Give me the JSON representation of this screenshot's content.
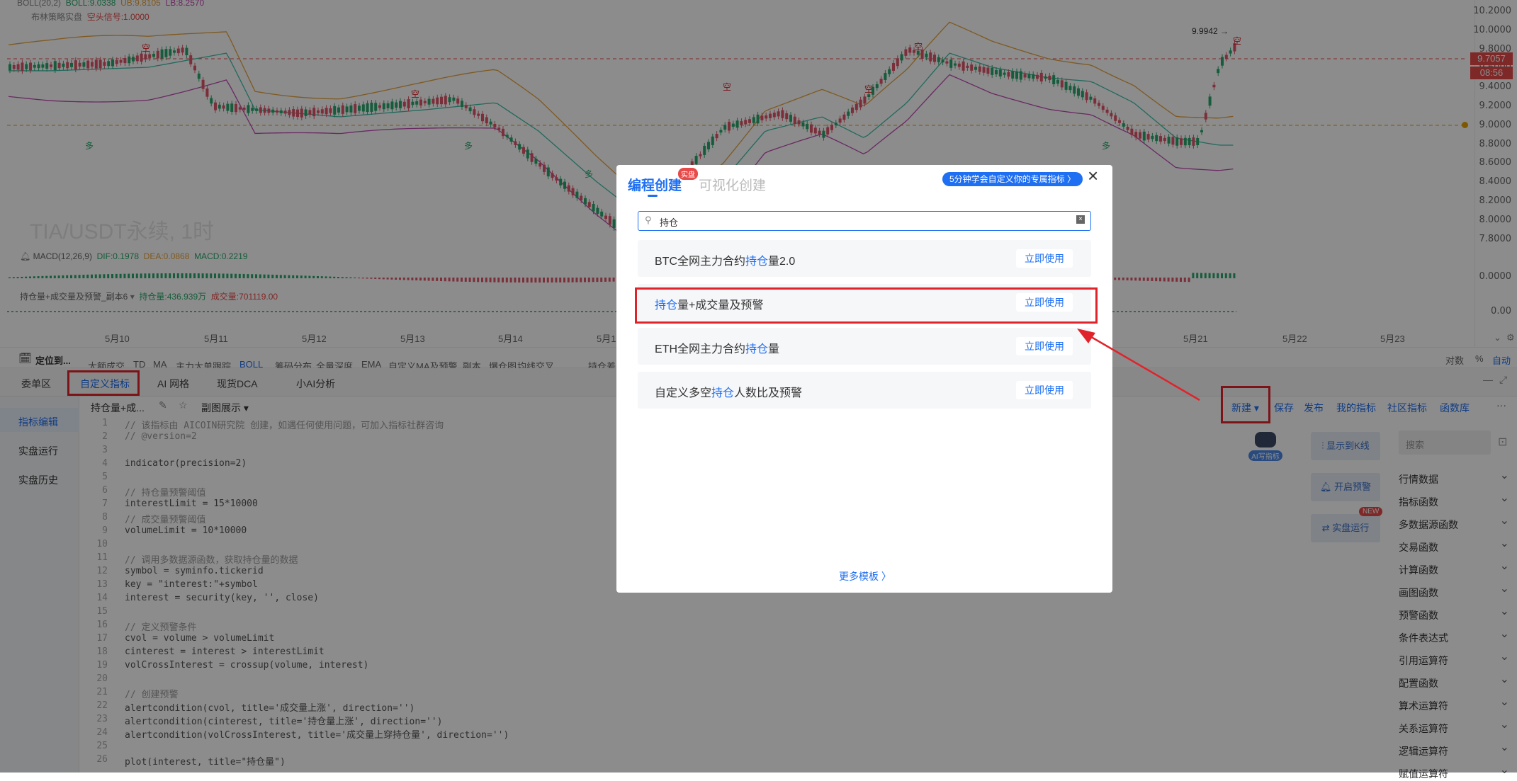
{
  "chart": {
    "boll_legend": "BOLL(20,2)",
    "boll_mid": "BOLL:9.0338",
    "boll_ub": "UB:9.8105",
    "boll_lb": "LB:8.2570",
    "strategy_name": "布林策略实盘",
    "strategy_signal": "空头信号:1.0000",
    "symbol_watermark": "TIA/USDT永续, 1时",
    "high_marker": "9.9942",
    "price_tag": "9.7057",
    "time_tag": "08:56",
    "macd_legend": "MACD(12,26,9)",
    "macd_dif": "DIF:0.1978",
    "macd_dea": "DEA:0.0868",
    "macd_val": "MACD:0.2219",
    "indicator_legend": "持仓量+成交量及预警_副本6",
    "interest_val": "持仓量:436.939万",
    "volume_val": "成交量:701119.00",
    "y_ticks": [
      "10.2000",
      "10.0000",
      "9.8000",
      "9.6000",
      "9.4000",
      "9.2000",
      "9.0000",
      "8.8000",
      "8.6000",
      "8.4000",
      "8.2000",
      "8.0000",
      "7.8000"
    ],
    "macd_tick": "0.0000",
    "ind_tick": "0.00",
    "x_ticks": [
      "5月10",
      "5月11",
      "5月12",
      "5月13",
      "5月14",
      "5月1",
      "5月21",
      "5月22",
      "5月23"
    ],
    "axis_opts": [
      "对数",
      "%",
      "自动"
    ],
    "sell_marker": "空",
    "buy_marker": "多"
  },
  "toolbar": {
    "locate": "定位到...",
    "items": [
      "大额成交",
      "TD",
      "MA",
      "主力大单跟踪",
      "BOLL",
      "筹码分布",
      "全量深度",
      "EMA",
      "自定义MA及预警_副本",
      "爆仓图",
      "均线交叉",
      "持仓差"
    ]
  },
  "tabs": [
    "委单区",
    "自定义指标",
    "AI 网格",
    "现货DCA",
    "小AI分析"
  ],
  "leftnav": [
    "指标编辑",
    "实盘运行",
    "实盘历史"
  ],
  "editorbar": {
    "script_name": "持仓量+成...",
    "display": "副图展示"
  },
  "actions": [
    "新建",
    "保存",
    "发布",
    "我的指标",
    "社区指标",
    "函数库"
  ],
  "side": {
    "ai_label": "AI写指标",
    "show_kline": "显示到K线",
    "alert": "开启预警",
    "live": "实盘运行",
    "new_badge": "NEW",
    "search_placeholder": "搜索"
  },
  "functions": [
    "行情数据",
    "指标函数",
    "多数据源函数",
    "交易函数",
    "计算函数",
    "画图函数",
    "预警函数",
    "条件表达式",
    "引用运算符",
    "配置函数",
    "算术运算符",
    "关系运算符",
    "逻辑运算符",
    "赋值运算符"
  ],
  "code": [
    "// 该指标由 AICOIN研究院 创建，如遇任何使用问题，可加入指标社群咨询",
    "// @version=2",
    "",
    "indicator(precision=2)",
    "",
    "// 持仓量预警阈值",
    "interestLimit = 15*10000",
    "// 成交量预警阈值",
    "volumeLimit = 10*10000",
    "",
    "// 调用多数据源函数，获取持仓量的数据",
    "symbol = syminfo.tickerid",
    "key = \"interest:\"+symbol",
    "interest = security(key, '', close)",
    "",
    "// 定义预警条件",
    "cvol = volume > volumeLimit",
    "cinterest = interest > interestLimit",
    "volCrossInterest = crossup(volume, interest)",
    "",
    "// 创建预警",
    "alertcondition(cvol, title='成交量上涨', direction='')",
    "alertcondition(cinterest, title='持仓量上涨', direction='')",
    "alertcondition(volCrossInterest, title='成交量上穿持仓量', direction='')",
    "",
    "plot(interest, title=\"持仓量\")"
  ],
  "modal": {
    "tab_code": "编程创建",
    "badge": "实盘",
    "tab_visual": "可视化创建",
    "promo": "5分钟学会自定义你的专属指标 〉",
    "close": "×",
    "search_value": "持仓",
    "use_label": "立即使用",
    "templates": [
      {
        "pre": "BTC全网主力合约",
        "hl": "持仓",
        "post": "量2.0"
      },
      {
        "pre": "",
        "hl": "持仓",
        "post": "量+成交量及预警"
      },
      {
        "pre": "ETH全网主力合约",
        "hl": "持仓",
        "post": "量"
      },
      {
        "pre": "自定义多空",
        "hl": "持仓",
        "post": "人数比及预警"
      }
    ],
    "more": "更多模板 〉"
  }
}
